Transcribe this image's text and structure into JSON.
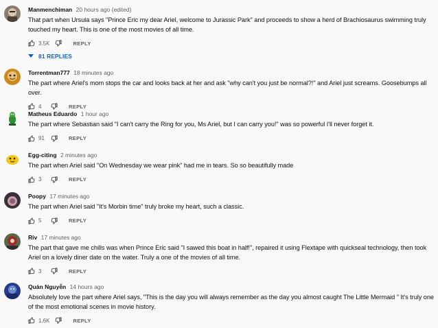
{
  "comments": [
    {
      "author": "Manmenchiman",
      "time": "20 hours ago (edited)",
      "text": "That part when Ursula says \"Prince Eric my dear Ariel, welcome to Jurassic Park\" and proceeds to show a herd of Brachiosaurus swimming truly touched my heart. This is one of the most movies of all time.",
      "likes": "3.5K",
      "reply_label": "REPLY",
      "replies_label": "81 REPLIES"
    },
    {
      "author": "Torrentman777",
      "time": "18 minutes ago",
      "text": "The part where Ariel's mom stops the car and looks back at her and ask \"why can't you just be normal?!\" and Ariel just screams. Goosebumps all over.",
      "likes": "4",
      "reply_label": "REPLY"
    },
    {
      "author": "Matheus Eduardo",
      "time": "1 hour ago",
      "text": "The part where Sebastian said \"I can't carry the Ring for you, Ms Ariel, but I can carry you!\" was so powerful  I'll never forget it.",
      "likes": "91",
      "reply_label": "REPLY"
    },
    {
      "author": "Egg-citing",
      "time": "2 minutes ago",
      "text": "The part when Ariel said \"On Wednesday we wear pink\" had me in tears. So so beautifully made",
      "likes": "3",
      "reply_label": "REPLY"
    },
    {
      "author": "Poopy",
      "time": "17 minutes ago",
      "text": "The part when Ariel said \"It's Morbin time\" truly broke my heart, such a classic.",
      "likes": "5",
      "reply_label": "REPLY"
    },
    {
      "author": "Riv",
      "time": "17 minutes ago",
      "text": "The part that gave me chills was when Prince Eric said \"I sawed this boat in half!\", repaired it using Flextape with quickseal technology, then took Ariel on a lovely diner date on the water. Truly a one of the movies of all time.",
      "likes": "3",
      "reply_label": "REPLY"
    },
    {
      "author": "Quán Nguyễn",
      "time": "14 hours ago",
      "text": "Absolutely love the part where Ariel says, \"This is the day you will always remember as the day you almost caught The Little Mermaid \" It's truly one of the most emotional scenes in movie history.",
      "likes": "1.6K",
      "reply_label": "REPLY"
    }
  ],
  "colors": {
    "link_blue": "#065fd4",
    "muted": "#606060",
    "background": "#f9f9f9"
  },
  "icons": {
    "like": "thumbs-up-icon",
    "dislike": "thumbs-down-icon",
    "expand": "caret-down-icon"
  }
}
